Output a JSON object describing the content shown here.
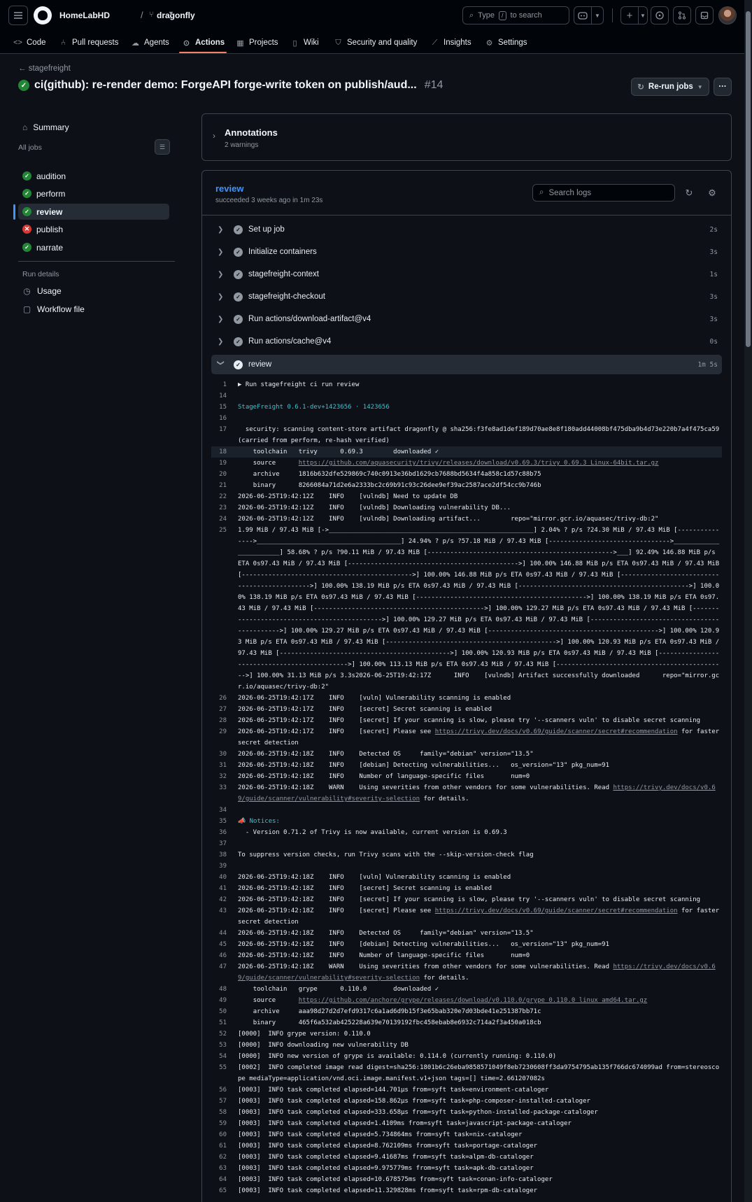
{
  "header": {
    "owner": "HomeLabHD",
    "repo": "dragonfly",
    "search_placeholder_pre": "Type",
    "search_key": "/",
    "search_placeholder_post": "to search"
  },
  "nav_tabs": [
    {
      "label": "Code",
      "icon": "code-icon"
    },
    {
      "label": "Pull requests",
      "icon": "pull-request-icon"
    },
    {
      "label": "Agents",
      "icon": "agents-icon"
    },
    {
      "label": "Actions",
      "icon": "play-icon",
      "selected": true
    },
    {
      "label": "Projects",
      "icon": "table-icon"
    },
    {
      "label": "Wiki",
      "icon": "book-icon"
    },
    {
      "label": "Security and quality",
      "icon": "shield-icon"
    },
    {
      "label": "Insights",
      "icon": "graph-icon"
    },
    {
      "label": "Settings",
      "icon": "gear-icon"
    }
  ],
  "run": {
    "back_label": "stagefreight",
    "title": "ci(github): re-render demo: ForgeAPI forge-write token on publish/aud...",
    "number": "#14",
    "rerun_label": "Re-run jobs"
  },
  "sidebar": {
    "summary": "Summary",
    "all_jobs": "All jobs",
    "jobs": [
      {
        "name": "audition",
        "status": "success"
      },
      {
        "name": "perform",
        "status": "success"
      },
      {
        "name": "review",
        "status": "success",
        "selected": true
      },
      {
        "name": "publish",
        "status": "failure"
      },
      {
        "name": "narrate",
        "status": "success"
      }
    ],
    "run_details": "Run details",
    "usage": "Usage",
    "workflow_file": "Workflow file"
  },
  "annotations": {
    "title": "Annotations",
    "subtitle": "2 warnings"
  },
  "job": {
    "name": "review",
    "status_text": "succeeded 3 weeks ago in 1m 23s",
    "search_placeholder": "Search logs",
    "steps": [
      {
        "name": "Set up job",
        "duration": "2s"
      },
      {
        "name": "Initialize containers",
        "duration": "3s"
      },
      {
        "name": "stagefreight-context",
        "duration": "1s"
      },
      {
        "name": "stagefreight-checkout",
        "duration": "3s"
      },
      {
        "name": "Run actions/download-artifact@v4",
        "duration": "3s"
      },
      {
        "name": "Run actions/cache@v4",
        "duration": "0s"
      },
      {
        "name": "review",
        "duration": "1m 5s",
        "expanded": true
      }
    ]
  },
  "log_lines": [
    {
      "n": "1",
      "t": "▶ Run stagefreight ci run review"
    },
    {
      "n": "14",
      "t": ""
    },
    {
      "n": "15",
      "t": "StageFreight 0.6.1-dev+1423656 · 1423656",
      "style": "cyan"
    },
    {
      "n": "16",
      "t": ""
    },
    {
      "n": "17",
      "t": "  security: scanning content-store artifact dragonfly @ sha256:f3fe8ad1def189d70ae8e8f180add44008bf475dba9b4d73e220b7a4f475ca59 (carried from perform, re-hash verified)"
    },
    {
      "n": "18",
      "t": "    toolchain   trivy      0.69.3        downloaded ✓",
      "highlight": true
    },
    {
      "n": "19",
      "t": "    source      ",
      "link": "https://github.com/aquasecurity/trivy/releases/download/v0.69.3/trivy_0.69.3_Linux-64bit.tar.gz"
    },
    {
      "n": "20",
      "t": "    archive     1816b632dfe529869c740c0913e36bd1629cb7688bd5634f4a858c1d57c88b75"
    },
    {
      "n": "21",
      "t": "    binary      8266084a71d2e6a2333bc2c69b91c93c26dee9ef39ac2587ace2df54cc9b746b"
    },
    {
      "n": "22",
      "t": "2026-06-25T19:42:12Z    INFO    [vulndb] Need to update DB"
    },
    {
      "n": "23",
      "t": "2026-06-25T19:42:12Z    INFO    [vulndb] Downloading vulnerability DB..."
    },
    {
      "n": "24",
      "t": "2026-06-25T19:42:12Z    INFO    [vulndb] Downloading artifact...        repo=\"mirror.gcr.io/aquasec/trivy-db:2\""
    },
    {
      "n": "25",
      "t": "1.99 MiB / 97.43 MiB [->______________________________________________________] 2.04% ? p/s ?24.30 MiB / 97.43 MiB [--------------->______________________________________] 24.94% ? p/s ?57.18 MiB / 97.43 MiB [-------------------------------->_______________________] 58.68% ? p/s ?90.11 MiB / 97.43 MiB [------------------------------------------------->___] 92.49% 146.88 MiB p/s ETA 0s97.43 MiB / 97.43 MiB [--------------------------------------------->] 100.00% 146.88 MiB p/s ETA 0s97.43 MiB / 97.43 MiB [--------------------------------------------->] 100.00% 146.88 MiB p/s ETA 0s97.43 MiB / 97.43 MiB [--------------------------------------------->] 100.00% 138.19 MiB p/s ETA 0s97.43 MiB / 97.43 MiB [--------------------------------------------->] 100.00% 138.19 MiB p/s ETA 0s97.43 MiB / 97.43 MiB [--------------------------------------------->] 100.00% 138.19 MiB p/s ETA 0s97.43 MiB / 97.43 MiB [--------------------------------------------->] 100.00% 129.27 MiB p/s ETA 0s97.43 MiB / 97.43 MiB [--------------------------------------------->] 100.00% 129.27 MiB p/s ETA 0s97.43 MiB / 97.43 MiB [--------------------------------------------->] 100.00% 129.27 MiB p/s ETA 0s97.43 MiB / 97.43 MiB [--------------------------------------------->] 100.00% 120.93 MiB p/s ETA 0s97.43 MiB / 97.43 MiB [--------------------------------------------->] 100.00% 120.93 MiB p/s ETA 0s97.43 MiB / 97.43 MiB [--------------------------------------------->] 100.00% 120.93 MiB p/s ETA 0s97.43 MiB / 97.43 MiB [--------------------------------------------->] 100.00% 113.13 MiB p/s ETA 0s97.43 MiB / 97.43 MiB [--------------------------------------------->] 100.00% 31.13 MiB p/s 3.3s2026-06-25T19:42:17Z      INFO    [vulndb] Artifact successfully downloaded      repo=\"mirror.gcr.io/aquasec/trivy-db:2\""
    },
    {
      "n": "26",
      "t": "2026-06-25T19:42:17Z    INFO    [vuln] Vulnerability scanning is enabled"
    },
    {
      "n": "27",
      "t": "2026-06-25T19:42:17Z    INFO    [secret] Secret scanning is enabled"
    },
    {
      "n": "28",
      "t": "2026-06-25T19:42:17Z    INFO    [secret] If your scanning is slow, please try '--scanners vuln' to disable secret scanning"
    },
    {
      "n": "29",
      "t": "2026-06-25T19:42:17Z    INFO    [secret] Please see ",
      "link": "https://trivy.dev/docs/v0.69/guide/scanner/secret#recommendation",
      "after": " for faster secret detection"
    },
    {
      "n": "30",
      "t": "2026-06-25T19:42:18Z    INFO    Detected OS     family=\"debian\" version=\"13.5\""
    },
    {
      "n": "31",
      "t": "2026-06-25T19:42:18Z    INFO    [debian] Detecting vulnerabilities...   os_version=\"13\" pkg_num=91"
    },
    {
      "n": "32",
      "t": "2026-06-25T19:42:18Z    INFO    Number of language-specific files       num=0"
    },
    {
      "n": "33",
      "t": "2026-06-25T19:42:18Z    WARN    Using severities from other vendors for some vulnerabilities. Read ",
      "link": "https://trivy.dev/docs/v0.69/guide/scanner/vulnerability#severity-selection",
      "after": " for details."
    },
    {
      "n": "34",
      "t": ""
    },
    {
      "n": "35",
      "t": "📣 Notices:",
      "style": "cyan"
    },
    {
      "n": "36",
      "t": "  - Version 0.71.2 of Trivy is now available, current version is 0.69.3"
    },
    {
      "n": "37",
      "t": ""
    },
    {
      "n": "38",
      "t": "To suppress version checks, run Trivy scans with the --skip-version-check flag"
    },
    {
      "n": "39",
      "t": ""
    },
    {
      "n": "40",
      "t": "2026-06-25T19:42:18Z    INFO    [vuln] Vulnerability scanning is enabled"
    },
    {
      "n": "41",
      "t": "2026-06-25T19:42:18Z    INFO    [secret] Secret scanning is enabled"
    },
    {
      "n": "42",
      "t": "2026-06-25T19:42:18Z    INFO    [secret] If your scanning is slow, please try '--scanners vuln' to disable secret scanning"
    },
    {
      "n": "43",
      "t": "2026-06-25T19:42:18Z    INFO    [secret] Please see ",
      "link": "https://trivy.dev/docs/v0.69/guide/scanner/secret#recommendation",
      "after": " for faster secret detection"
    },
    {
      "n": "44",
      "t": "2026-06-25T19:42:18Z    INFO    Detected OS     family=\"debian\" version=\"13.5\""
    },
    {
      "n": "45",
      "t": "2026-06-25T19:42:18Z    INFO    [debian] Detecting vulnerabilities...   os_version=\"13\" pkg_num=91"
    },
    {
      "n": "46",
      "t": "2026-06-25T19:42:18Z    INFO    Number of language-specific files       num=0"
    },
    {
      "n": "47",
      "t": "2026-06-25T19:42:18Z    WARN    Using severities from other vendors for some vulnerabilities. Read ",
      "link": "https://trivy.dev/docs/v0.69/guide/scanner/vulnerability#severity-selection",
      "after": " for details."
    },
    {
      "n": "48",
      "t": "    toolchain   grype      0.110.0       downloaded ✓"
    },
    {
      "n": "49",
      "t": "    source      ",
      "link": "https://github.com/anchore/grype/releases/download/v0.110.0/grype_0.110.0_linux_amd64.tar.gz"
    },
    {
      "n": "50",
      "t": "    archive     aaa98d27d2d7efd9317c6a1ad6d9b15f3e65bab320e7d03bde41e251387bb71c"
    },
    {
      "n": "51",
      "t": "    binary      465f6a532ab425228a639e70139192fbc458ebab8e6932c714a2f3a450a018cb"
    },
    {
      "n": "52",
      "t": "[0000]  INFO grype version: 0.110.0"
    },
    {
      "n": "53",
      "t": "[0000]  INFO downloading new vulnerability DB"
    },
    {
      "n": "54",
      "t": "[0000]  INFO new version of grype is available: 0.114.0 (currently running: 0.110.0)"
    },
    {
      "n": "55",
      "t": "[0002]  INFO completed image read digest=sha256:1801b6c26eba9858571049f8eb7230608ff3da9754795ab135f766dc674099ad from=stereoscope mediaType=application/vnd.oci.image.manifest.v1+json tags=[] time=2.661207082s"
    },
    {
      "n": "56",
      "t": "[0003]  INFO task completed elapsed=144.701µs from=syft task=environment-cataloger"
    },
    {
      "n": "57",
      "t": "[0003]  INFO task completed elapsed=158.862µs from=syft task=php-composer-installed-cataloger"
    },
    {
      "n": "58",
      "t": "[0003]  INFO task completed elapsed=333.658µs from=syft task=python-installed-package-cataloger"
    },
    {
      "n": "59",
      "t": "[0003]  INFO task completed elapsed=1.4109ms from=syft task=javascript-package-cataloger"
    },
    {
      "n": "60",
      "t": "[0003]  INFO task completed elapsed=5.734864ms from=syft task=nix-cataloger"
    },
    {
      "n": "61",
      "t": "[0003]  INFO task completed elapsed=8.762109ms from=syft task=portage-cataloger"
    },
    {
      "n": "62",
      "t": "[0003]  INFO task completed elapsed=9.41687ms from=syft task=alpm-db-cataloger"
    },
    {
      "n": "63",
      "t": "[0003]  INFO task completed elapsed=9.975779ms from=syft task=apk-db-cataloger"
    },
    {
      "n": "64",
      "t": "[0003]  INFO task completed elapsed=10.678575ms from=syft task=conan-info-cataloger"
    },
    {
      "n": "65",
      "t": "[0003]  INFO task completed elapsed=11.329828ms from=syft task=rpm-db-cataloger"
    }
  ],
  "colors": {
    "bg": "#0d1117",
    "header_bg": "#010409",
    "accent": "#4493f8",
    "success": "#238636",
    "failure": "#da3633",
    "tab_underline": "#f78166"
  }
}
